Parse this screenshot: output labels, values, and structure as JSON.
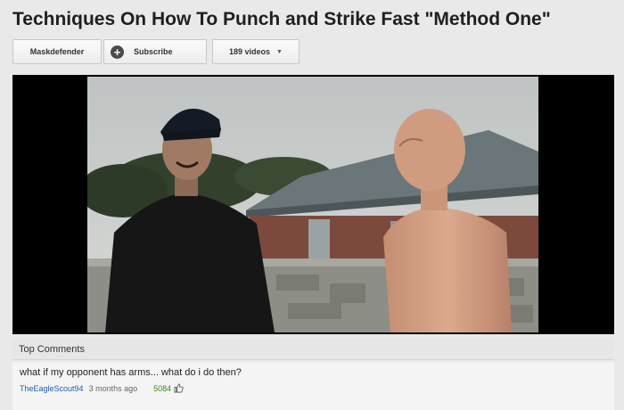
{
  "video": {
    "title": "Techniques On How To Punch and Strike Fast \"Method One\""
  },
  "channel": {
    "name_label": "Maskdefender",
    "subscribe_label": "Subscribe",
    "videos_label": "189 videos"
  },
  "comments": {
    "header": "Top Comments",
    "items": [
      {
        "text": "what if my opponent has arms... what do i do then?",
        "author": "TheEagleScout94",
        "time": "3 months ago",
        "likes": "5084"
      }
    ]
  },
  "icons": {
    "subscribe": "plus-circle-icon",
    "videos_dropdown": "chevron-down-icon",
    "like": "thumbs-up-icon"
  },
  "colors": {
    "author_link": "#1a5fb4",
    "likes": "#3a8a22"
  }
}
